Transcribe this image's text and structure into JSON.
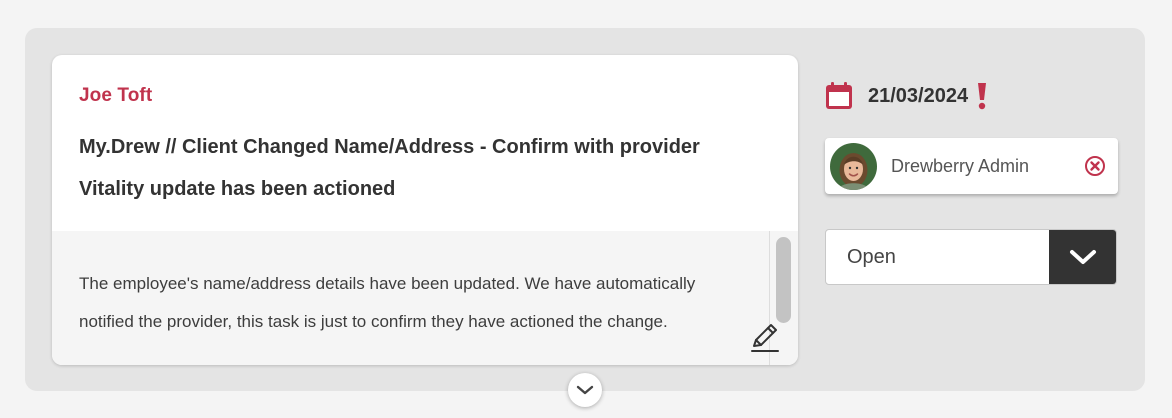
{
  "task": {
    "client_name": "Joe Toft",
    "title": "My.Drew // Client Changed Name/Address - Confirm with provider",
    "subtitle": "Vitality update has been actioned",
    "description": "The employee's name/address details have been updated. We have automatically notified the provider, this task is just to confirm they have actioned the change."
  },
  "due": {
    "date": "21/03/2024",
    "overdue_icon": "exclamation-icon"
  },
  "assignee": {
    "name": "Drewberry Admin",
    "remove_icon": "remove-circle-icon"
  },
  "status": {
    "selected": "Open"
  },
  "colors": {
    "accent": "#c0334d",
    "panel_bg": "#e4e4e4",
    "body_bg": "#f5f5f5",
    "dark": "#333333"
  },
  "icons": {
    "calendar": "calendar-icon",
    "edit": "pencil-icon",
    "expand": "chevron-down-icon",
    "dropdown": "chevron-down-icon"
  }
}
